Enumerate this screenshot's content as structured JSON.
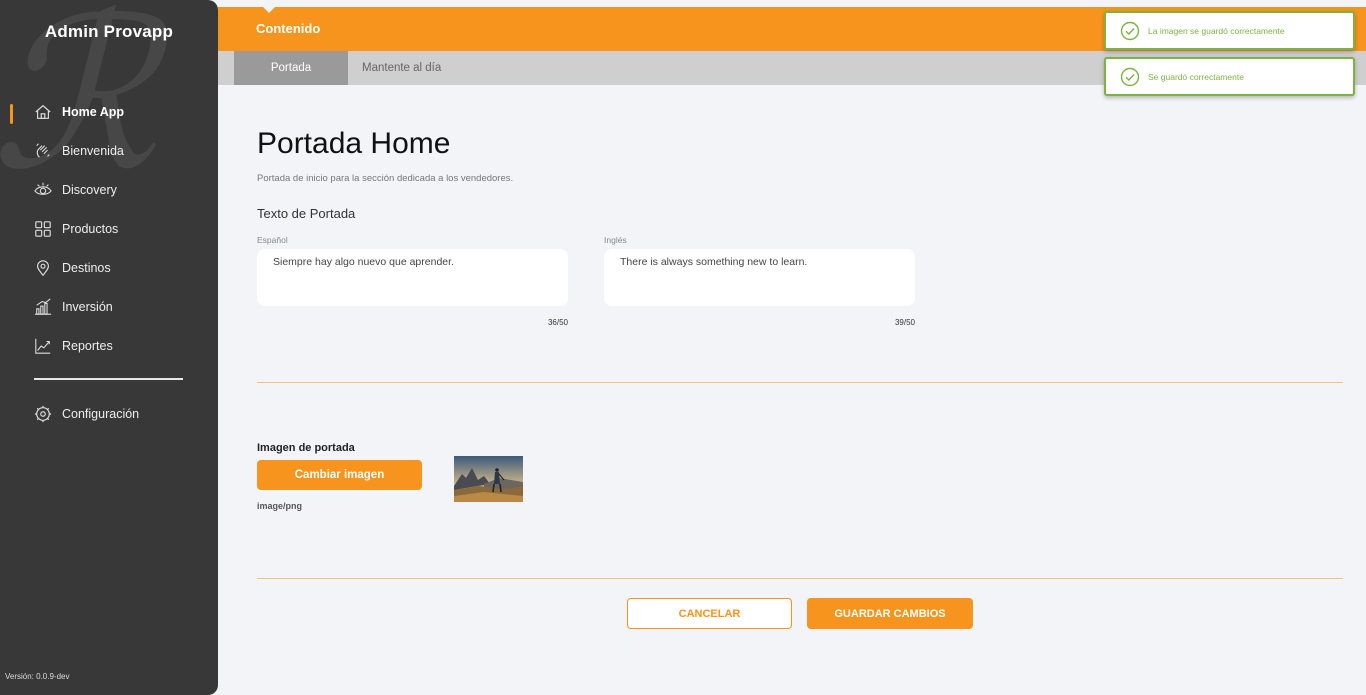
{
  "sidebar": {
    "brand": "Admin Provapp",
    "items": [
      {
        "label": "Home App",
        "icon": "home-icon"
      },
      {
        "label": "Bienvenida",
        "icon": "waving-hand-icon"
      },
      {
        "label": "Discovery",
        "icon": "eye-icon"
      },
      {
        "label": "Productos",
        "icon": "grid-icon"
      },
      {
        "label": "Destinos",
        "icon": "location-pin-icon"
      },
      {
        "label": "Inversión",
        "icon": "bar-chart-icon"
      },
      {
        "label": "Reportes",
        "icon": "trend-chart-icon"
      }
    ],
    "settings": {
      "label": "Configuración",
      "icon": "gear-icon"
    },
    "version": "Versión: 0.0.9-dev"
  },
  "header": {
    "title": "Contenido",
    "tabs": [
      {
        "label": "Portada",
        "active": true
      },
      {
        "label": "Mantente al día",
        "active": false
      }
    ]
  },
  "main": {
    "title": "Portada Home",
    "subtitle": "Portada de inicio para la sección dedicada a los vendedores.",
    "section_label": "Texto de Portada",
    "fields": [
      {
        "label": "Español",
        "value": "Siempre hay algo nuevo que aprender.",
        "counter": "36/50"
      },
      {
        "label": "Inglés",
        "value": "There is always something new to learn.",
        "counter": "39/50"
      }
    ],
    "image": {
      "label": "Imagen de portada",
      "button": "Cambiar imagen",
      "mime": "image/png"
    },
    "actions": {
      "cancel": "CANCELAR",
      "save": "GUARDAR CAMBIOS"
    }
  },
  "toasts": [
    {
      "message": "La imagen se guardó correctamente"
    },
    {
      "message": "Se guardó correctamente"
    }
  ],
  "colors": {
    "accent": "#f7941d",
    "sidebar": "#383838",
    "success": "#7cb342"
  }
}
